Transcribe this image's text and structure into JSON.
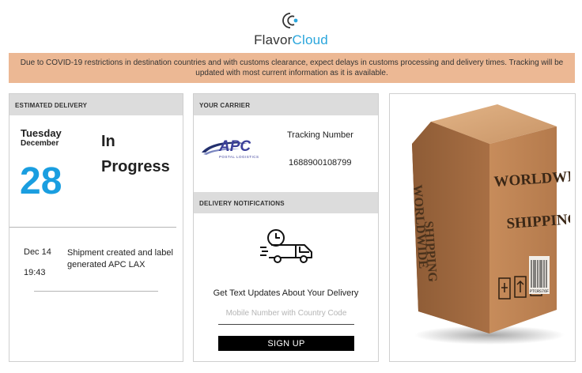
{
  "brand": {
    "name_part1": "Flavor",
    "name_part2": "Cloud",
    "accent": "#2aa6dc"
  },
  "notice": {
    "text": "Due to COVID-19 restrictions in destination countries and with customs clearance, expect delays in customs processing and delivery times. Tracking will be updated with most current information as it is available.",
    "background": "#ecb894"
  },
  "estimated_delivery": {
    "header": "ESTIMATED DELIVERY",
    "weekday": "Tuesday",
    "month": "December",
    "day": "28",
    "day_color": "#1a9ee0",
    "status": "In Progress",
    "events": [
      {
        "date": "Dec 14",
        "time": "19:43",
        "description": "Shipment created and label generated APC LAX"
      }
    ]
  },
  "carrier": {
    "header": "YOUR CARRIER",
    "logo_text": "APC",
    "logo_subtext": "POSTAL LOGISTICS",
    "tracking_label": "Tracking Number",
    "tracking_number": "1688900108799"
  },
  "notifications": {
    "header": "DELIVERY NOTIFICATIONS",
    "icon": "delivery-truck-clock-icon",
    "prompt": "Get Text Updates About Your Delivery",
    "phone_placeholder": "Mobile Number with Country Code",
    "phone_value": "",
    "signup_label": "SIGN UP"
  },
  "shipping_image": {
    "box_text_line1": "WORLDWIDE",
    "box_text_line2": "SHIPPING",
    "barcode_text": "PTCRS76F"
  }
}
